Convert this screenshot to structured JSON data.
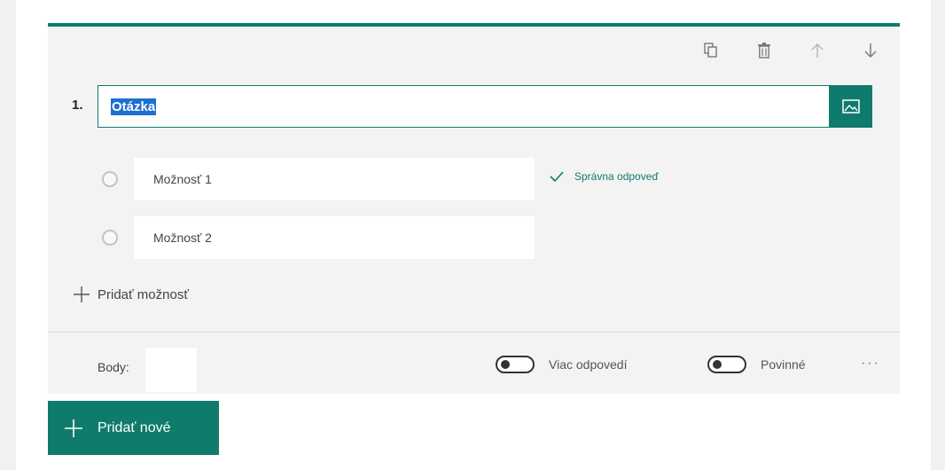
{
  "question": {
    "number": "1.",
    "text": "Otázka"
  },
  "toolbar": {
    "icons": [
      "copy-icon",
      "delete-icon",
      "arrow-up-icon",
      "arrow-down-icon"
    ]
  },
  "options": [
    {
      "label": "Možnosť 1",
      "correct_label": "Správna odpoveď"
    },
    {
      "label": "Možnosť 2"
    }
  ],
  "add_option_label": "Pridať možnosť",
  "footer": {
    "points_label": "Body:",
    "multiple_answers_label": "Viac odpovedí",
    "required_label": "Povinné",
    "more_label": "···"
  },
  "add_new_label": "Pridať nové",
  "colors": {
    "accent": "#0f7b6c",
    "selection": "#1f6fd0"
  }
}
